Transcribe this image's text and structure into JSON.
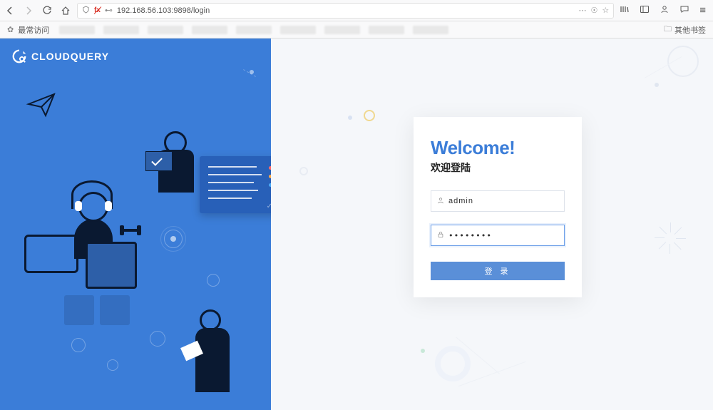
{
  "browser": {
    "url": "192.168.56.103:9898/login",
    "bookmarks_label": "最常访问",
    "other_bookmarks": "其他书签"
  },
  "brand": {
    "name": "CLOUDQUERY"
  },
  "login": {
    "welcome": "Welcome!",
    "subtitle": "欢迎登陆",
    "username_value": "admin",
    "password_value": "••••••••",
    "button_label": "登 录"
  },
  "colors": {
    "primary": "#3b7dd8",
    "dark": "#0a1931",
    "button": "#5a8fd8"
  }
}
